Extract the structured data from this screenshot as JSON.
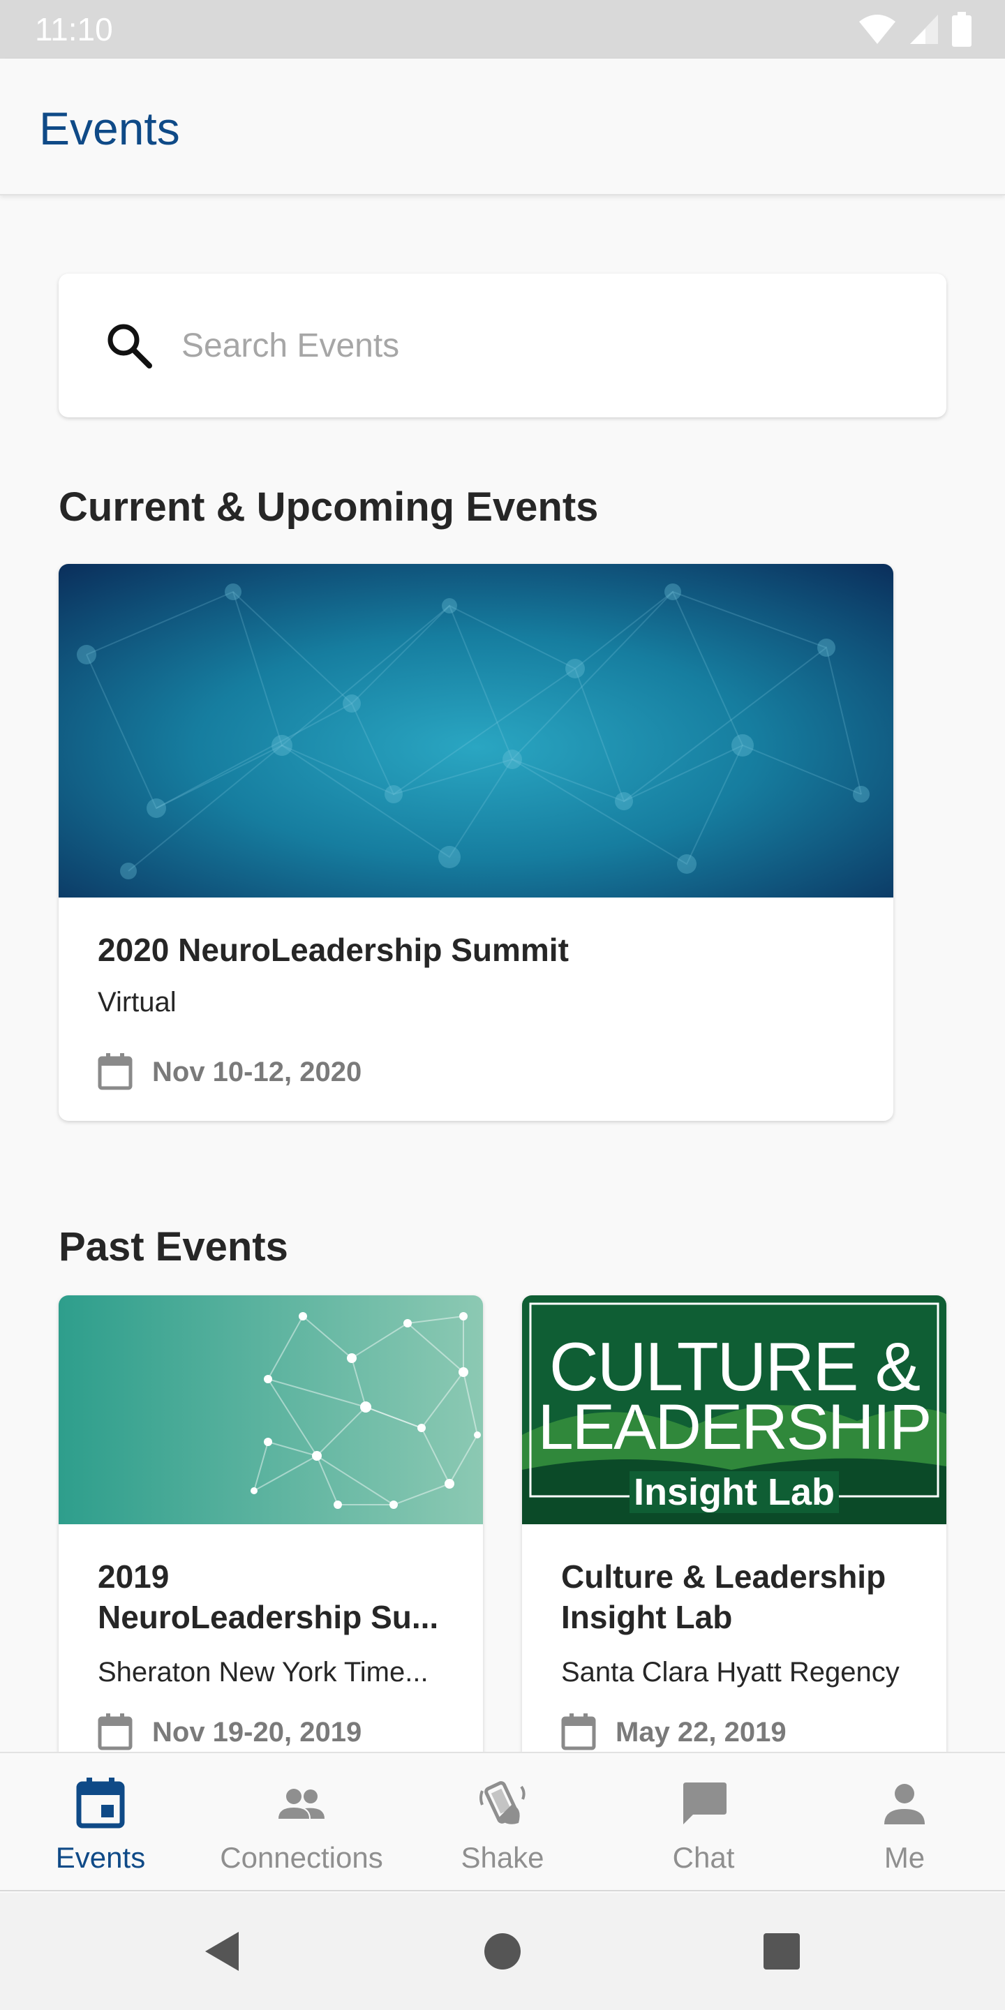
{
  "status_bar": {
    "time": "11:10"
  },
  "app_bar": {
    "title": "Events"
  },
  "search": {
    "placeholder": "Search Events"
  },
  "sections": {
    "current_title": "Current & Upcoming Events",
    "past_title": "Past Events"
  },
  "current_events": [
    {
      "title": "2020 NeuroLeadership Summit",
      "location": "Virtual",
      "date": "Nov 10-12, 2020"
    }
  ],
  "past_events": [
    {
      "title_line1": "2019",
      "title_line2": "NeuroLeadership Su...",
      "location": "Sheraton New York Time...",
      "date": "Nov 19-20, 2019"
    },
    {
      "title_line1": "Culture & Leadership",
      "title_line2": "Insight Lab",
      "location": "Santa Clara Hyatt Regency",
      "date": "May 22, 2019",
      "image_text": {
        "line1": "CULTURE &",
        "line2": "LEADERSHIP",
        "line3": "Insight Lab"
      }
    }
  ],
  "bottom_nav": {
    "items": [
      {
        "label": "Events",
        "icon": "calendar-icon",
        "active": true
      },
      {
        "label": "Connections",
        "icon": "people-icon",
        "active": false
      },
      {
        "label": "Shake",
        "icon": "shake-phone-icon",
        "active": false
      },
      {
        "label": "Chat",
        "icon": "chat-bubble-icon",
        "active": false
      },
      {
        "label": "Me",
        "icon": "person-icon",
        "active": false
      }
    ]
  },
  "colors": {
    "brand": "#0f4a87",
    "inactive": "#8f8f8f",
    "text": "#262626",
    "muted": "#7a7a7a"
  }
}
